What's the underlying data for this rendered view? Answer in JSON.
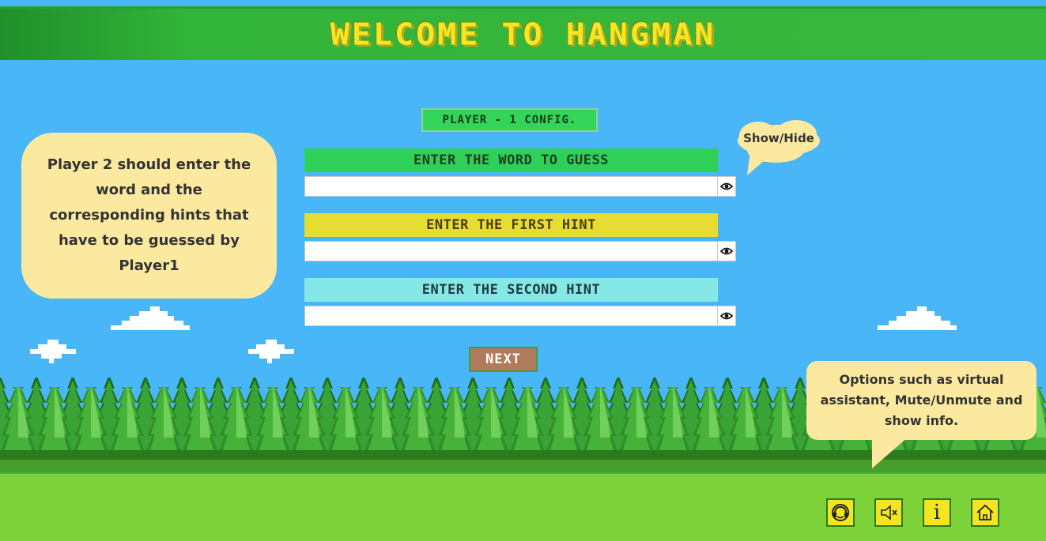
{
  "header": {
    "title": "WELCOME TO HANGMAN"
  },
  "config": {
    "label": "PLAYER - 1 CONFIG."
  },
  "fields": {
    "word": {
      "label": "ENTER THE WORD TO GUESS",
      "value": "",
      "placeholder": ""
    },
    "hint1": {
      "label": "ENTER THE FIRST HINT",
      "value": "",
      "placeholder": ""
    },
    "hint2": {
      "label": "ENTER THE SECOND HINT",
      "value": "",
      "placeholder": ""
    }
  },
  "buttons": {
    "next": "NEXT"
  },
  "tooltips": {
    "left": "Player 2 should enter the word and the corresponding hints that have to be guessed by Player1",
    "show_hide": "Show/Hide",
    "options": "Options such as virtual assistant, Mute/Unmute and show info."
  },
  "toolbar": {
    "icons": [
      "assistant-icon",
      "mute-icon",
      "info-icon",
      "home-icon"
    ],
    "info_glyph": "i"
  },
  "colors": {
    "sky": "#49b6f7",
    "header_green": "#38b83c",
    "title_yellow": "#f2e825",
    "tooltip_bg": "#fce9a0",
    "next_bg": "#b07a5c",
    "icon_bg": "#f3e51f"
  }
}
